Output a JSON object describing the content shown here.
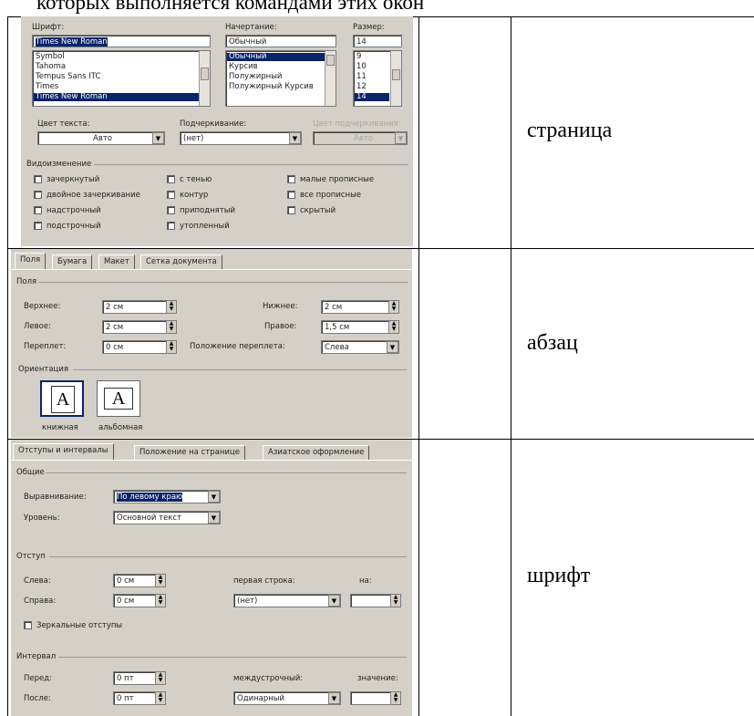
{
  "heading_fragment": "которых выполняется командами этих окон",
  "answers": [
    "страница",
    "абзац",
    "шрифт"
  ],
  "font_dialog": {
    "font_label": "Шрифт:",
    "font_value": "Times New Roman",
    "font_list": [
      "Symbol",
      "Tahoma",
      "Tempus Sans ITC",
      "Times",
      "Times New Roman"
    ],
    "style_label": "Начертание:",
    "style_value": "Обычный",
    "style_list": [
      "Обычный",
      "Курсив",
      "Полужирный",
      "Полужирный Курсив"
    ],
    "size_label": "Размер:",
    "size_value": "14",
    "size_list": [
      "9",
      "10",
      "11",
      "12",
      "14"
    ],
    "color_label": "Цвет текста:",
    "color_value": "Авто",
    "underline_label": "Подчеркивание:",
    "underline_value": "(нет)",
    "underline_color_label": "Цвет подчеркивания:",
    "underline_color_value": "Авто",
    "effects_label": "Видоизменение",
    "effects": [
      "зачеркнутый",
      "двойное зачеркивание",
      "надстрочный",
      "подстрочный",
      "с тенью",
      "контур",
      "приподнятый",
      "утопленный",
      "малые прописные",
      "все прописные",
      "скрытый"
    ]
  },
  "page_dialog": {
    "tabs": [
      "Поля",
      "Бумага",
      "Макет",
      "Сетка документа"
    ],
    "fields_label": "Поля",
    "top_label": "Верхнее:",
    "top_value": "2 см",
    "bottom_label": "Нижнее:",
    "bottom_value": "2 см",
    "left_label": "Левое:",
    "left_value": "2 см",
    "right_label": "Правое:",
    "right_value": "1,5 см",
    "gutter_label": "Переплет:",
    "gutter_value": "0 см",
    "gutter_pos_label": "Положение переплета:",
    "gutter_pos_value": "Слева",
    "orientation_label": "Ориентация",
    "portrait_label": "книжная",
    "landscape_label": "альбомная"
  },
  "para_dialog": {
    "tabs": [
      "Отступы и интервалы",
      "Положение на странице",
      "Азиатское оформление"
    ],
    "general_label": "Общие",
    "align_label": "Выравнивание:",
    "align_value": "По левому краю",
    "level_label": "Уровень:",
    "level_value": "Основной текст",
    "indent_label": "Отступ",
    "left_label": "Слева:",
    "left_value": "0 см",
    "right_label": "Справа:",
    "right_value": "0 см",
    "first_line_label": "первая строка:",
    "first_line_value": "(нет)",
    "by_label": "на:",
    "mirror_label": "Зеркальные отступы",
    "spacing_label": "Интервал",
    "before_label": "Перед:",
    "before_value": "0 пт",
    "after_label": "После:",
    "after_value": "0 пт",
    "line_spacing_label": "междустрочный:",
    "line_spacing_value": "Одинарный",
    "value_label": "значение:"
  }
}
